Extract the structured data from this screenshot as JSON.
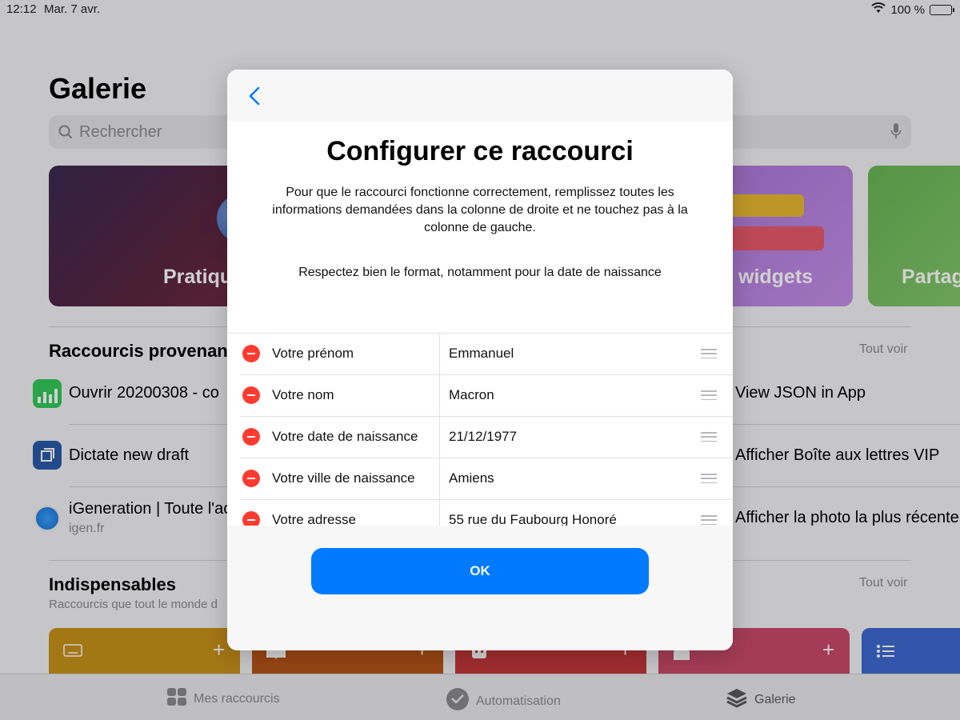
{
  "status_bar": {
    "time": "12:12",
    "date": "Mar. 7 avr.",
    "battery": "100 %",
    "battery_level": 1.0
  },
  "gallery": {
    "title": "Galerie",
    "search_placeholder": "Rechercher",
    "tiles": [
      {
        "label": "Pratique",
        "color": "#5a2540"
      },
      {
        "label": "widgets",
        "color": "#b27fdc"
      },
      {
        "label": "Partag",
        "color": "#74bc5e"
      }
    ],
    "section1": {
      "title": "Raccourcis provenan",
      "see_all": "Tout voir",
      "items_left": [
        {
          "label": "Ouvrir 20200308 - co",
          "icon": "numbers-icon"
        },
        {
          "label": "Dictate new draft",
          "icon": "drafts-icon"
        },
        {
          "label": "iGeneration | Toute l'ac",
          "sub": "igen.fr",
          "icon": "safari-icon"
        }
      ],
      "items_right": [
        {
          "label": "View JSON in App"
        },
        {
          "label": "Afficher Boîte aux lettres VIP"
        },
        {
          "label": "Afficher la photo la plus récente"
        }
      ]
    },
    "section2": {
      "title": "Indispensables",
      "subtitle": "Raccourcis que tout le monde d",
      "see_all": "Tout voir",
      "cards": [
        {
          "color": "#c8921a",
          "icon": "keyboard-icon"
        },
        {
          "color": "#b85518",
          "icon": "book-icon"
        },
        {
          "color": "#c4383a",
          "icon": "robot-icon"
        },
        {
          "color": "#c84a68",
          "icon": "house-icon"
        },
        {
          "color": "#3d6ad0",
          "icon": "list-icon"
        }
      ]
    }
  },
  "tab_bar": {
    "tabs": [
      {
        "label": "Mes raccourcis",
        "icon": "grid-icon"
      },
      {
        "label": "Automatisation",
        "icon": "check-circle-icon"
      },
      {
        "label": "Galerie",
        "icon": "layers-icon"
      }
    ]
  },
  "modal": {
    "title": "Configurer ce raccourci",
    "description": "Pour que le raccourci fonctionne correctement, remplissez toutes les informations demandées dans la colonne de droite et ne touchez pas à la colonne de gauche.",
    "note": "Respectez bien le format, notamment pour la date de naissance",
    "rows": [
      {
        "label": "Votre prénom",
        "value": "Emmanuel"
      },
      {
        "label": "Votre nom",
        "value": "Macron"
      },
      {
        "label": "Votre date de naissance",
        "value": "21/12/1977"
      },
      {
        "label": "Votre ville de naissance",
        "value": "Amiens"
      },
      {
        "label": "Votre adresse",
        "value": "55 rue du Faubourg Honoré"
      }
    ],
    "ok_label": "OK",
    "accent": "#007aff",
    "remove_color": "#ff3b30"
  }
}
